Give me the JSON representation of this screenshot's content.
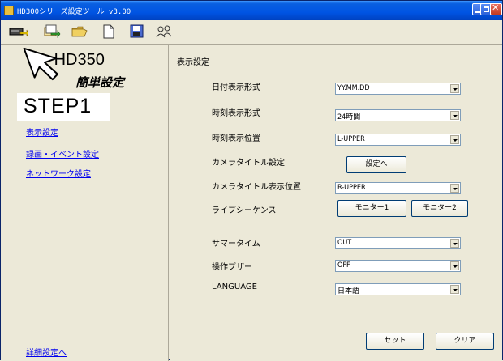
{
  "window": {
    "title": "HD300シリーズ設定ツール v3.00"
  },
  "toolbar": {
    "icons": [
      "connect-icon",
      "transfer-icon",
      "open-folder-icon",
      "new-file-icon",
      "save-icon",
      "users-icon"
    ]
  },
  "sidebar": {
    "model": "HD350",
    "subtitle": "簡単設定",
    "step": "STEP1",
    "links": [
      "表示設定",
      "録画・イベント設定",
      "ネットワーク設定"
    ],
    "advanced_link": "詳細設定へ"
  },
  "main": {
    "section_title": "表示設定",
    "rows": [
      {
        "label": "日付表示形式",
        "value": "YY.MM.DD"
      },
      {
        "label": "時刻表示形式",
        "value": "24時間"
      },
      {
        "label": "時刻表示位置",
        "value": "L-UPPER"
      },
      {
        "label": "カメラタイトル設定",
        "button": "設定へ"
      },
      {
        "label": "カメラタイトル表示位置",
        "value": "R-UPPER"
      },
      {
        "label": "ライブシーケンス",
        "buttons": [
          "モニター1",
          "モニター2"
        ]
      },
      {
        "label": "サマータイム",
        "value": "OUT"
      },
      {
        "label": "操作ブザー",
        "value": "OFF"
      },
      {
        "label": "LANGUAGE",
        "value": "日本語"
      }
    ],
    "set_button": "セット",
    "clear_button": "クリア"
  },
  "colors": {
    "titlebar": "#0054e3",
    "link": "#0000ee",
    "panel": "#ece9d8"
  }
}
